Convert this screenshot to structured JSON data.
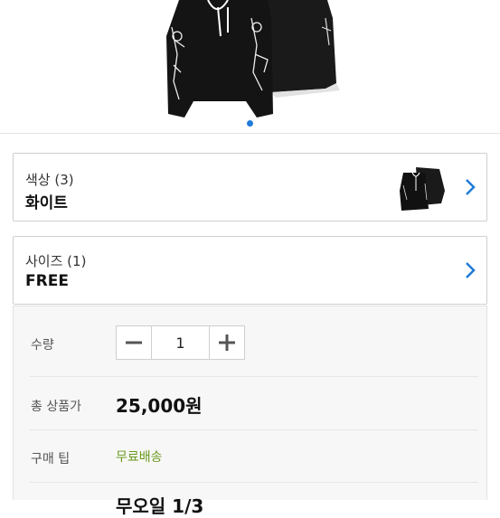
{
  "product": {
    "image_icon": "hoodie-image"
  },
  "carousel": {
    "active_index": 1
  },
  "color_option": {
    "label": "색상 (3)",
    "value": "화이트",
    "thumb_icon": "hoodie-thumbnail"
  },
  "size_option": {
    "label": "사이즈 (1)",
    "value": "FREE"
  },
  "quantity": {
    "label": "수량",
    "value": "1",
    "minus_icon": "minus-icon",
    "plus_icon": "plus-icon"
  },
  "total": {
    "label": "총 상품가",
    "value": "25,000원"
  },
  "tip": {
    "label": "구매 팁",
    "value": "무료배송"
  },
  "partial_row": {
    "value": "무오일 1/3"
  },
  "colors": {
    "accent": "#1f7bd8",
    "tip_green": "#6a9a1f"
  }
}
